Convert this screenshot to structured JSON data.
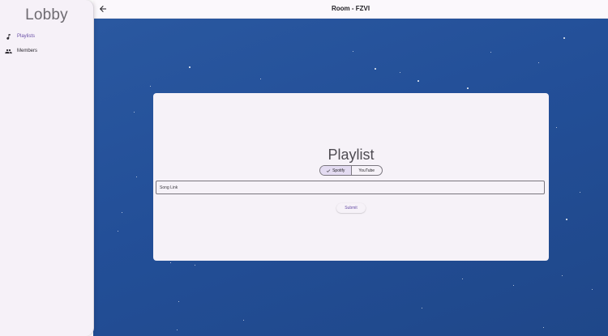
{
  "sidebar": {
    "title": "Lobby",
    "items": [
      {
        "label": "Playlists",
        "icon": "music-note-icon",
        "active": true
      },
      {
        "label": "Members",
        "icon": "group-icon",
        "active": false
      }
    ]
  },
  "topbar": {
    "title": "Room - FZVI",
    "back_icon": "arrow-left-icon"
  },
  "card": {
    "title": "Playlist",
    "sources": [
      {
        "label": "Spotify",
        "selected": true
      },
      {
        "label": "YouTube",
        "selected": false
      }
    ],
    "song_link_placeholder": "Song Link",
    "submit_label": "Submit"
  },
  "colors": {
    "accent": "#6a50a7",
    "background_blue": "#234f98",
    "sidebar_bg": "#f6f1f8",
    "card_bg": "#f6f2f8"
  }
}
